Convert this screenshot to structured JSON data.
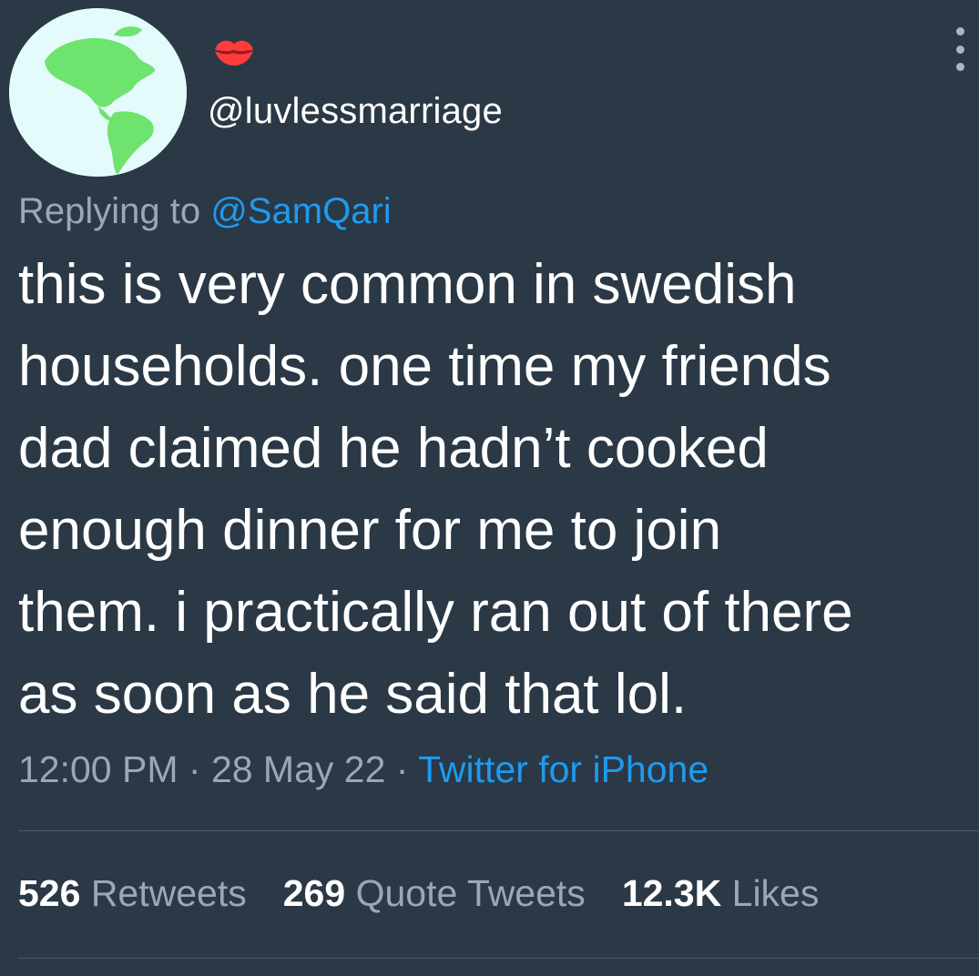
{
  "user": {
    "display_name_icon": "kiss-mark-emoji",
    "handle": "@luvlessmarriage",
    "avatar_icon": "globe-americas-icon"
  },
  "reply": {
    "prefix": "Replying to",
    "to_handle": "@SamQari"
  },
  "tweet": {
    "text": "this is very common in swedish\nhouseholds. one time my friends\ndad claimed he hadn’t cooked\nenough dinner for me to join\nthem. i practically ran out of there\nas soon as he said that lol."
  },
  "meta": {
    "time": "12:00 PM",
    "sep1": " · ",
    "date": "28 May 22",
    "sep2": " · ",
    "source": "Twitter for iPhone"
  },
  "stats": {
    "retweets_count": "526",
    "retweets_label": "Retweets",
    "quotes_count": "269",
    "quotes_label": "Quote Tweets",
    "likes_count": "12.3K",
    "likes_label": "Likes"
  },
  "colors": {
    "background": "#2b3845",
    "link": "#1d9bf0",
    "secondary_text": "#9aa8b6",
    "kiss": "#ff3b3b",
    "globe_land": "#6ee36e",
    "globe_water": "#e4fbfb"
  }
}
